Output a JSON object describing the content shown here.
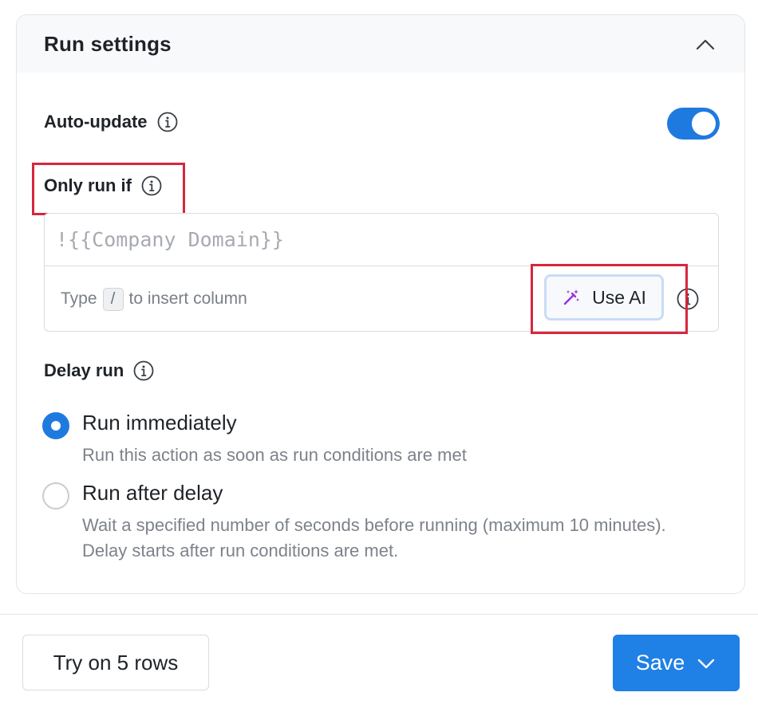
{
  "panel": {
    "title": "Run settings",
    "collapse_icon": "chevron-up-icon"
  },
  "auto_update": {
    "label": "Auto-update",
    "enabled": true
  },
  "only_run_if": {
    "label": "Only run if",
    "placeholder": "!{{Company Domain}}",
    "hint_prefix": "Type",
    "hint_key": "/",
    "hint_suffix": "to insert column",
    "use_ai_label": "Use AI",
    "use_ai_icon": "magic-wand-icon"
  },
  "delay_run": {
    "label": "Delay run",
    "options": [
      {
        "title": "Run immediately",
        "description": "Run this action as soon as run conditions are met",
        "selected": true
      },
      {
        "title": "Run after delay",
        "description": "Wait a specified number of seconds before running (maximum 10 minutes). Delay starts after run conditions are met.",
        "selected": false
      }
    ]
  },
  "footer": {
    "try_label": "Try on 5 rows",
    "save_label": "Save"
  },
  "colors": {
    "accent": "#1f7ae0",
    "highlight": "#d7263d",
    "ai_purple": "#9b30d9"
  }
}
